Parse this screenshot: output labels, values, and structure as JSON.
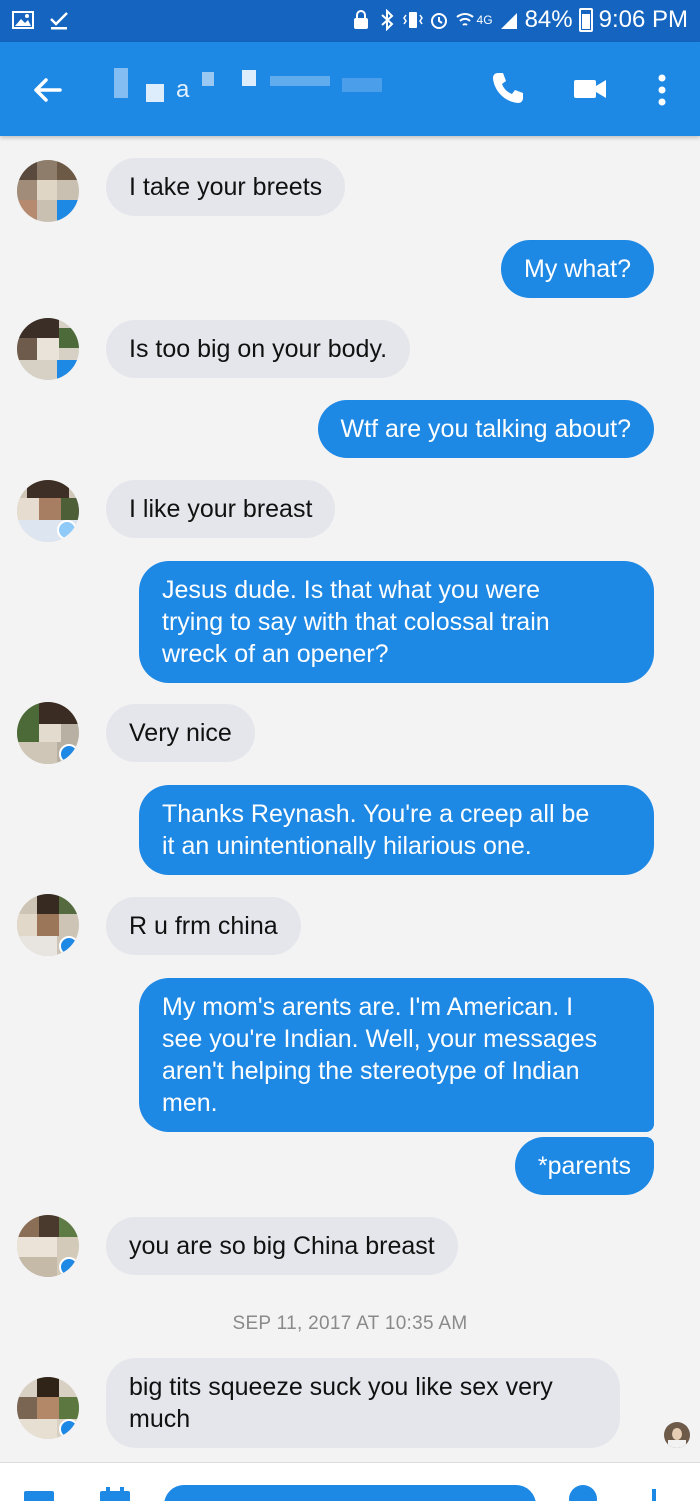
{
  "status_bar": {
    "battery": "84%",
    "time": "9:06 PM",
    "network": "4G"
  },
  "header": {
    "contact_name_partial": "a"
  },
  "messages": [
    {
      "dir": "in",
      "text": "I take your breets"
    },
    {
      "dir": "out",
      "text": "My what?"
    },
    {
      "dir": "in",
      "text": "Is too big on your body."
    },
    {
      "dir": "out",
      "text": "Wtf are you talking about?"
    },
    {
      "dir": "in",
      "text": "I like your breast"
    },
    {
      "dir": "out",
      "lines": [
        "Jesus dude. Is that what you were",
        "trying to say with that colossal train",
        "wreck of an opener?"
      ]
    },
    {
      "dir": "in",
      "text": "Very nice"
    },
    {
      "dir": "out",
      "lines": [
        "Thanks Reynash. You're a creep all be",
        "it an unintentionally hilarious one."
      ]
    },
    {
      "dir": "in",
      "text": "R u frm china"
    },
    {
      "dir": "out",
      "lines": [
        "My mom's arents are. I'm American. I",
        "see you're Indian. Well, your messages",
        "aren't helping the stereotype of Indian",
        "men."
      ]
    },
    {
      "dir": "out",
      "text": "*parents"
    },
    {
      "dir": "in",
      "text": "you are so big China breast"
    },
    {
      "dir": "in",
      "lines": [
        "big tits squeeze suck you like sex very",
        "much"
      ]
    }
  ],
  "timestamp": "SEP 11, 2017 AT 10:35 AM",
  "colors": {
    "status_bar": "#1565c0",
    "app_bar": "#1e88e5",
    "outgoing_bubble": "#1e88e5",
    "incoming_bubble": "#e4e6eb"
  }
}
